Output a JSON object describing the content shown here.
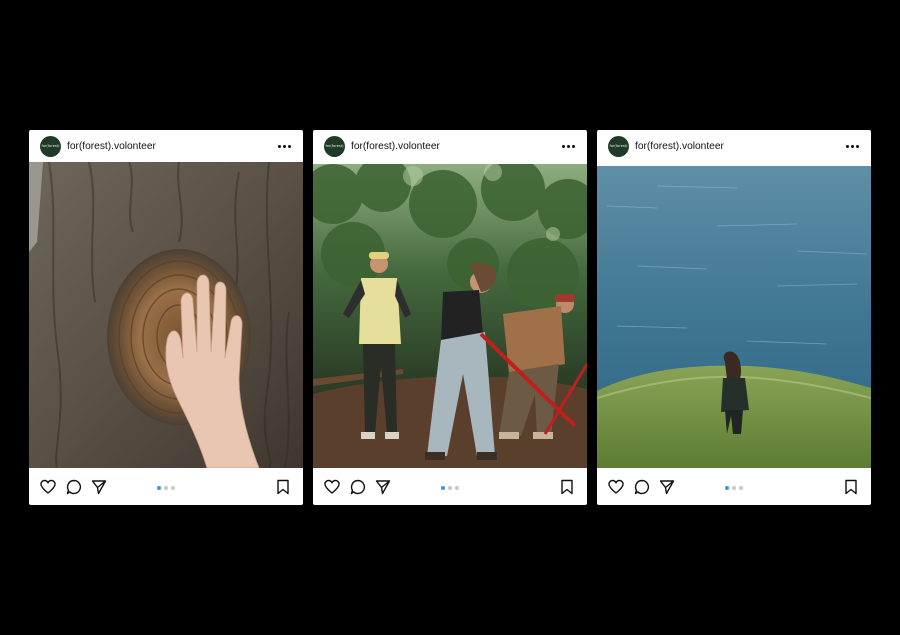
{
  "posts": [
    {
      "avatar_text": "for(forest)",
      "username": "for(forest).volonteer",
      "photo": "hand-on-tree-trunk",
      "carousel": {
        "count": 3,
        "active": 1
      }
    },
    {
      "avatar_text": "for(forest)",
      "username": "for(forest).volonteer",
      "photo": "volunteers-digging-in-forest",
      "carousel": {
        "count": 3,
        "active": 1
      }
    },
    {
      "avatar_text": "for(forest)",
      "username": "for(forest).volonteer",
      "photo": "woman-walking-toward-sea",
      "carousel": {
        "count": 3,
        "active": 1
      }
    }
  ],
  "icons": [
    "heart-icon",
    "comment-icon",
    "share-icon",
    "bookmark-icon",
    "more-options-icon"
  ],
  "colors": {
    "background": "#000000",
    "card": "#ffffff",
    "carousel_active": "#3b97e3",
    "carousel_inactive": "#c8c8c8",
    "avatar_bg": "#1f3a26"
  }
}
